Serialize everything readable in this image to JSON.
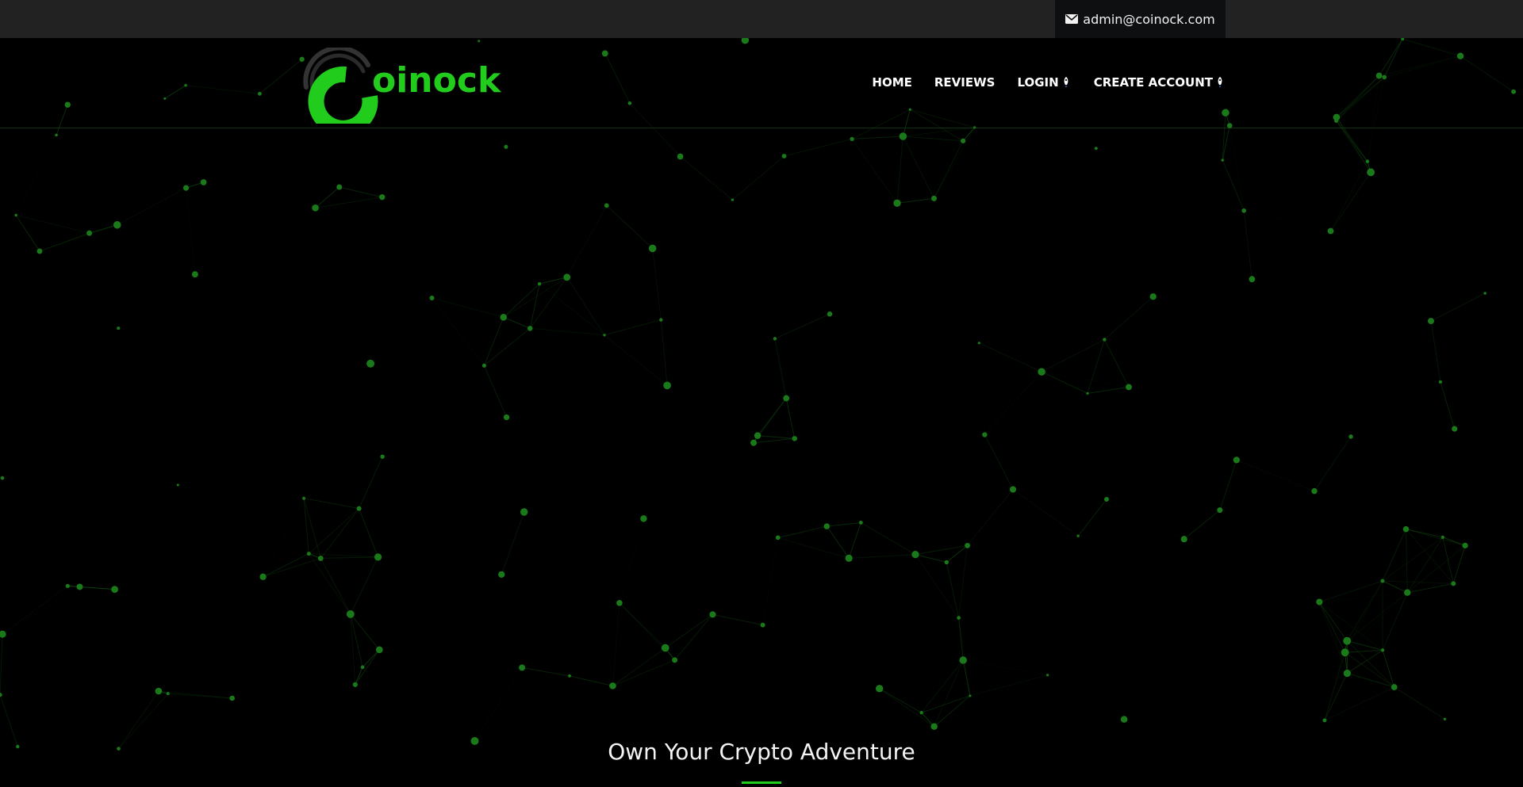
{
  "topbar": {
    "email": "admin@coinock.com",
    "email_icon": "envelope-icon"
  },
  "header": {
    "logo_text": "oinock",
    "nav": [
      {
        "label": "HOME"
      },
      {
        "label": "REVIEWS"
      },
      {
        "label": "LOGIN",
        "icon": "rocket-icon"
      },
      {
        "label": "CREATE ACCOUNT",
        "icon": "rocket-icon"
      }
    ]
  },
  "hero": {
    "title": "Own Your Crypto Adventure"
  },
  "colors": {
    "brand_green": "#21cc1d",
    "topbar_bg": "#222222",
    "email_bg": "#0e0f10",
    "network_node": "#1a7a1a",
    "background": "#000000"
  }
}
